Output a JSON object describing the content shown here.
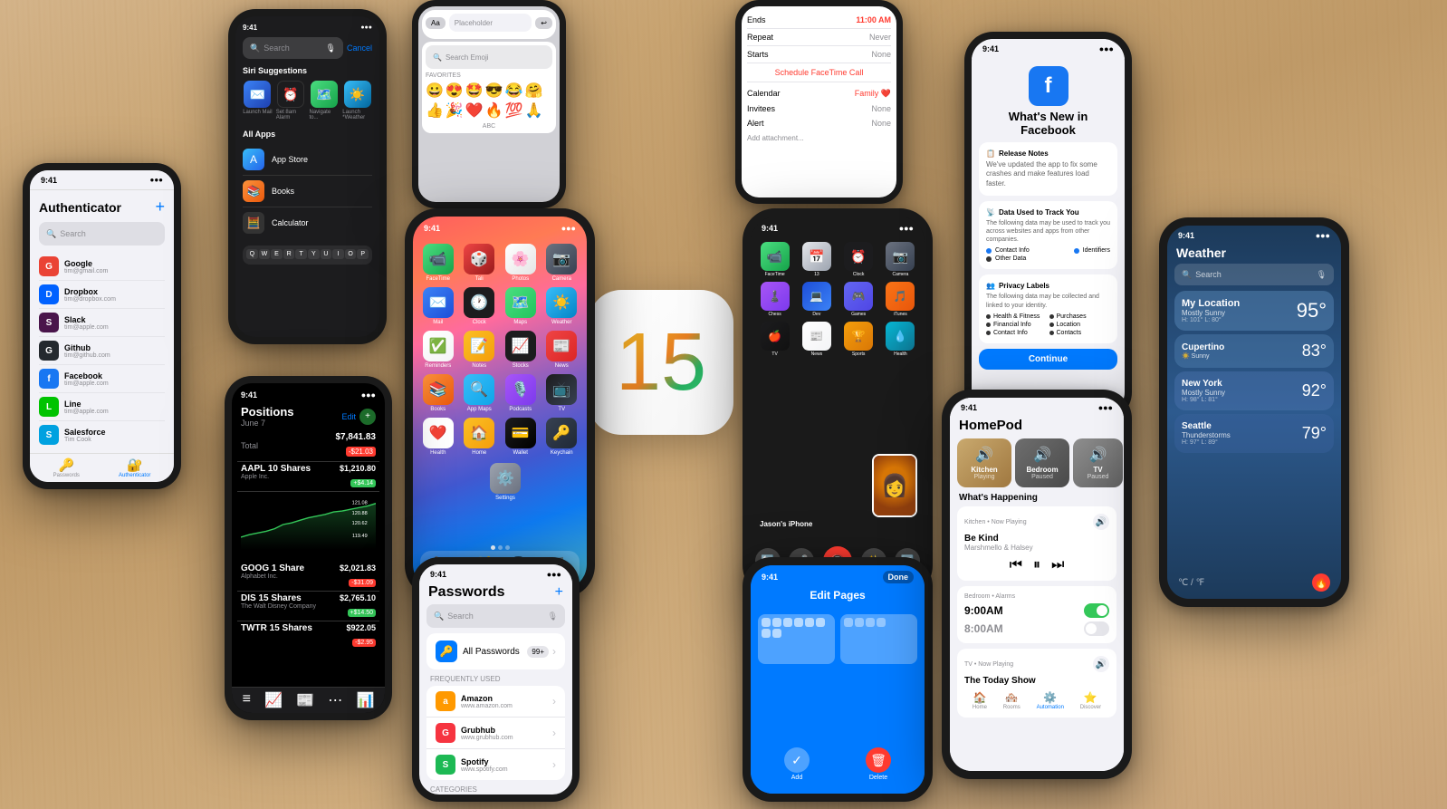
{
  "background": {
    "color": "#c8a872"
  },
  "ios_logo": {
    "number": "15"
  },
  "phones": {
    "authenticator": {
      "title": "Authenticator",
      "time": "9:41",
      "accounts": [
        {
          "name": "Google",
          "email": "tim@gmail.com",
          "icon": "G",
          "color": "#ea4335"
        },
        {
          "name": "Dropbox",
          "email": "tim@dropbox.com",
          "icon": "📦",
          "color": "#0061ff"
        },
        {
          "name": "Slack",
          "email": "tim@apple.com",
          "icon": "S",
          "color": "#4a154b"
        },
        {
          "name": "Github",
          "email": "tim@github.com",
          "icon": "G",
          "color": "#24292e"
        },
        {
          "name": "Facebook",
          "email": "tim@apple.com",
          "icon": "f",
          "color": "#1877f2"
        },
        {
          "name": "Line",
          "email": "tim@apple.com",
          "icon": "L",
          "color": "#00c300"
        },
        {
          "name": "Salesforce",
          "email": "Tim Cook",
          "icon": "S",
          "color": "#00a1e0"
        }
      ]
    },
    "spotlight": {
      "time": "9:41",
      "search_placeholder": "Search",
      "suggestions_label": "Siri Suggestions",
      "all_apps_label": "All Apps",
      "apps": [
        "App Store",
        "Books",
        "Calculator"
      ],
      "cancel": "Cancel"
    },
    "emoji": {
      "time": "9:41",
      "placeholder": "Placeholder",
      "search_placeholder": "Search Emoji",
      "favorites_label": "FAVORITES"
    },
    "calendar_event": {
      "time": "9:41",
      "ends_label": "Ends",
      "ends_value": "11:00 AM",
      "repeat_label": "Repeat",
      "repeat_value": "Never",
      "starts_label": "Starts",
      "starts_value": "None",
      "facetime_btn": "Schedule FaceTime Call",
      "calendar_label": "Calendar",
      "calendar_value": "Family",
      "invitees_label": "Invitees",
      "invitees_value": "None",
      "alert_label": "Alert",
      "alert_value": "None",
      "attachment": "Add attachment..."
    },
    "appstore": {
      "time": "9:41",
      "tabs": [
        "FaceTime",
        "Tali",
        "Photos",
        "Camera",
        "Mail",
        "Clock",
        "Maps",
        "Weather",
        "Reminders",
        "Notes",
        "Stocks",
        "News",
        "Books",
        "App Maps",
        "Podcasts",
        "TV",
        "Health",
        "Home",
        "Wallet",
        "Keychain",
        "Settings"
      ]
    },
    "facetime_home": {
      "time": "9:41",
      "phone_label": "Jason's iPhone",
      "controls": [
        "flip",
        "mute",
        "end",
        "effects",
        "share"
      ]
    },
    "facebook_whats_new": {
      "time": "9:41",
      "title": "What's New in Facebook",
      "release_notes": "Release Notes",
      "description": "We've updated the app to fix some crashes and make features load faster.",
      "data_tracking_title": "Data Used to Track You",
      "data_tracking_desc": "The following data may be used to track you across websites and apps from other companies.",
      "contact_info": "Contact Info",
      "identifiers": "Identifiers",
      "other_data": "Other Data",
      "privacy_labels_title": "Privacy Labels",
      "privacy_labels_desc": "The following data may be collected and linked to your identity.",
      "health_fitness": "Health & Fitness",
      "purchases": "Purchases",
      "financial_info": "Financial Info",
      "location": "Location",
      "contact_info2": "Contact Info",
      "contacts": "Contacts",
      "continue_btn": "Continue"
    },
    "stocks": {
      "time": "9:41",
      "title": "Positions",
      "date": "June 7",
      "edit": "Edit",
      "total_label": "Total",
      "total_value": "$7,841.83",
      "total_gain": "-$21.03",
      "stocks": [
        {
          "symbol": "AAPL",
          "shares": "10 Shares",
          "company": "Apple Inc.",
          "value": "$1,210.80",
          "change": "+$4.14"
        },
        {
          "symbol": "GOOG",
          "shares": "1 Share",
          "company": "Alphabet Inc.",
          "value": "$2,021.83",
          "change": "-$31.09"
        },
        {
          "symbol": "DIS",
          "shares": "15 Shares",
          "company": "The Walt Disney Company",
          "value": "$2,765.10",
          "change": "+$14.50"
        },
        {
          "symbol": "TWTR",
          "shares": "15 Shares",
          "company": "",
          "value": "$922.05",
          "change": "-$2.95"
        }
      ]
    },
    "passwords": {
      "time": "9:41",
      "title": "Passwords",
      "all_label": "All Passwords",
      "all_count": "99+",
      "frequently_used": "FREQUENTLY USED",
      "items": [
        "Amazon",
        "Grubhub",
        "Spotify"
      ],
      "categories": "CATEGORIES"
    },
    "edit_pages": {
      "time": "9:41",
      "done_btn": "Done",
      "title": "Edit Pages"
    },
    "homepod": {
      "time": "9:41",
      "title": "HomePod",
      "rooms": [
        {
          "name": "Kitchen",
          "status": "Playing"
        },
        {
          "name": "Bedroom",
          "status": "Paused"
        },
        {
          "name": "TV",
          "status": "Paused"
        }
      ],
      "whats_happening": "What's Happening",
      "kitchen_now_playing": "Kitchen • Now Playing",
      "song": "Be Kind",
      "artist": "Marshmello & Halsey",
      "bedroom_alarms": "Bedroom • Alarms",
      "alarm1": "9:00AM",
      "alarm2": "8:00AM",
      "tv_now_playing": "TV • Now Playing",
      "tv_show": "The Today Show"
    },
    "weather": {
      "time": "9:41",
      "title": "Weather",
      "search_placeholder": "Search",
      "my_location": "My Location",
      "my_temp": "95°",
      "my_condition": "Mostly Sunny",
      "my_hi_lo": "H: 101° L: 80°",
      "cupertino": "Cupertino",
      "cupertino_temp": "83°",
      "new_york": "New York",
      "new_york_temp": "92°",
      "new_york_condition": "Mostly Sunny",
      "new_york_hi_lo": "H: 98° L: 81°",
      "seattle": "Seattle",
      "seattle_temp": "79°",
      "seattle_condition": "Thunderstorms",
      "seattle_hi_lo": "H: 97° L: 89°"
    }
  }
}
